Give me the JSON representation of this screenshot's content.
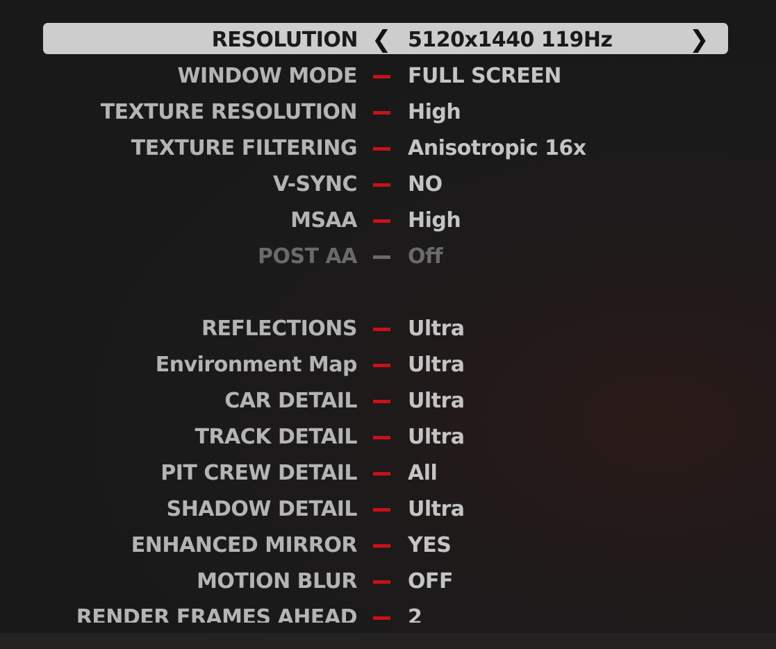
{
  "selected": {
    "label": "RESOLUTION",
    "value": "5120x1440 119Hz",
    "prev_icon": "chevron-left-icon",
    "next_icon": "chevron-right-icon"
  },
  "settings": [
    {
      "label": "WINDOW MODE",
      "value": "FULL SCREEN",
      "enabled": true
    },
    {
      "label": "TEXTURE RESOLUTION",
      "value": "High",
      "enabled": true
    },
    {
      "label": "TEXTURE FILTERING",
      "value": "Anisotropic 16x",
      "enabled": true
    },
    {
      "label": "V-SYNC",
      "value": "NO",
      "enabled": true
    },
    {
      "label": "MSAA",
      "value": "High",
      "enabled": true
    },
    {
      "label": "POST AA",
      "value": "Off",
      "enabled": false
    },
    {
      "label": "REFLECTIONS",
      "value": "Ultra",
      "enabled": true
    },
    {
      "label": "Environment Map",
      "value": "Ultra",
      "enabled": true
    },
    {
      "label": "CAR DETAIL",
      "value": "Ultra",
      "enabled": true
    },
    {
      "label": "TRACK DETAIL",
      "value": "Ultra",
      "enabled": true
    },
    {
      "label": "PIT CREW DETAIL",
      "value": "All",
      "enabled": true
    },
    {
      "label": "SHADOW DETAIL",
      "value": "Ultra",
      "enabled": true
    },
    {
      "label": "ENHANCED MIRROR",
      "value": "YES",
      "enabled": true
    },
    {
      "label": "MOTION BLUR",
      "value": "OFF",
      "enabled": true
    },
    {
      "label": "RENDER FRAMES AHEAD",
      "value": "2",
      "enabled": true
    }
  ],
  "colors": {
    "accent": "#c8101a",
    "highlight": "#cdcdcd",
    "text": "#b4b4b4",
    "disabled": "#6a6a6a"
  }
}
